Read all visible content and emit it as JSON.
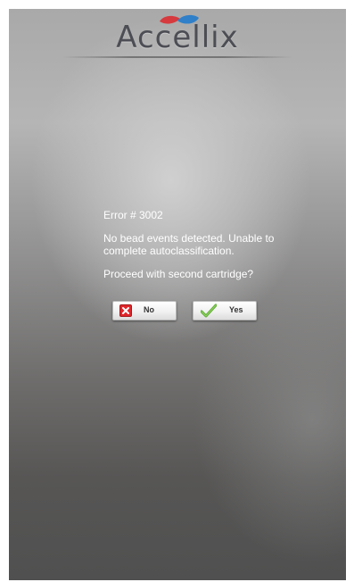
{
  "app": {
    "logo_text": "Accellix",
    "logo_colors": {
      "red": "#d63a3e",
      "blue": "#2f80c9",
      "text": "#4d4e55"
    }
  },
  "dialog": {
    "error_code": "Error # 3002",
    "message": "No bead events detected. Unable to complete autoclassification.",
    "prompt": "Proceed with second cartridge?",
    "buttons": {
      "no_label": "No",
      "no_icon": "red-x-icon",
      "yes_label": "Yes",
      "yes_icon": "green-check-icon"
    }
  }
}
